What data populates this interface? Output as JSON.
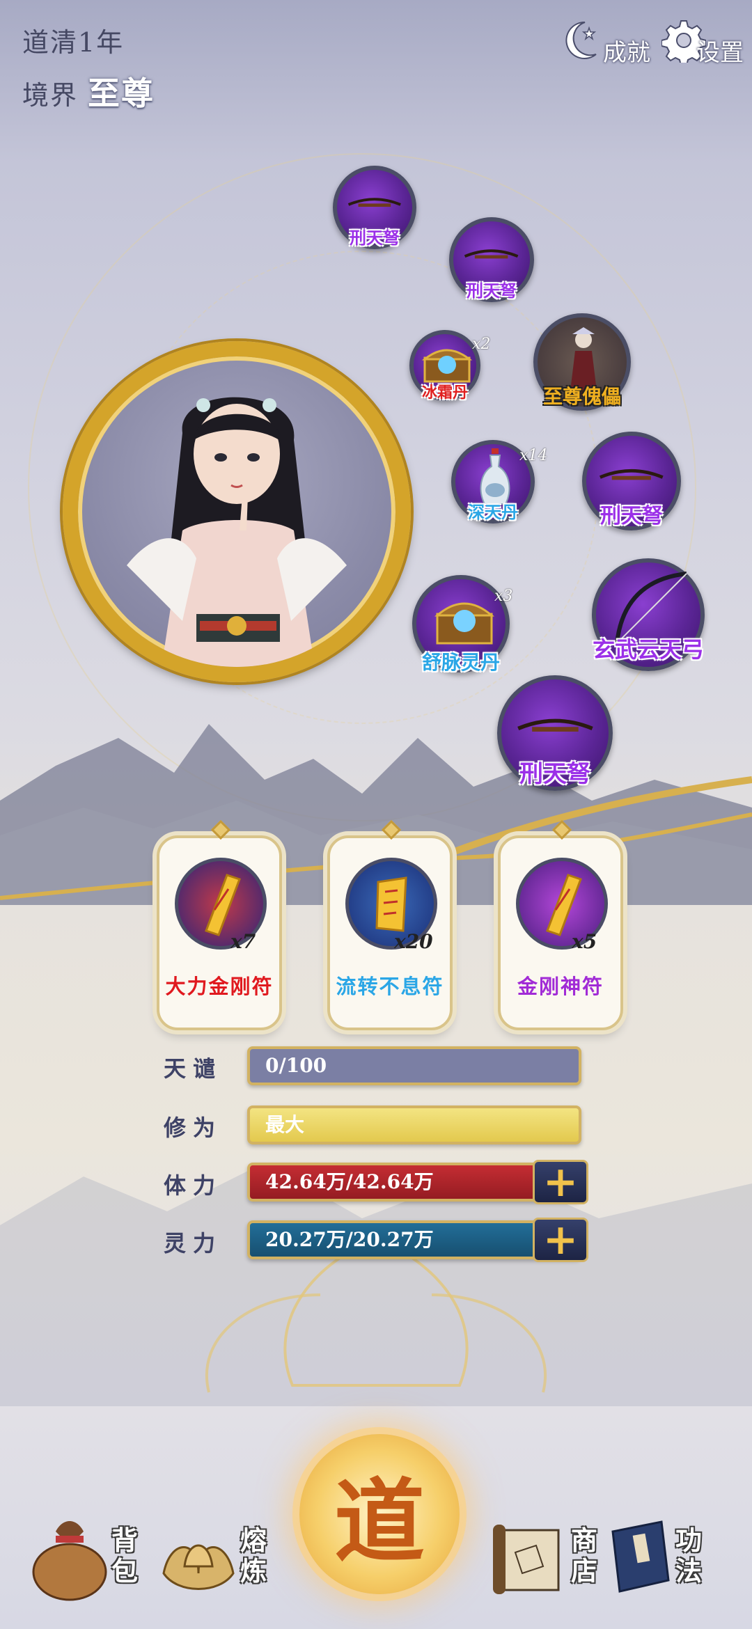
{
  "header": {
    "years": "道清1年",
    "realm_label": "境界",
    "realm_value": "至尊",
    "achievements_label": "成就",
    "settings_label": "设置"
  },
  "items": [
    {
      "name": "刑天弩",
      "kind": "bow-icon"
    },
    {
      "name": "刑天弩",
      "kind": "bow-icon"
    },
    {
      "name": "冰霜丹",
      "count": "x2",
      "kind": "chest-icon"
    },
    {
      "name": "至尊傀儡",
      "kind": "puppet-icon"
    },
    {
      "name": "深天丹",
      "count": "x14",
      "kind": "vase-icon"
    },
    {
      "name": "刑天弩",
      "kind": "bow-icon"
    },
    {
      "name": "舒脉灵丹",
      "count": "x3",
      "kind": "chest-icon"
    },
    {
      "name": "玄武云天弓",
      "kind": "longbow-icon"
    },
    {
      "name": "刑天弩",
      "kind": "bow-icon"
    }
  ],
  "talismans": [
    {
      "name": "大力金刚符",
      "count": "x7",
      "color": "#e0191f"
    },
    {
      "name": "流转不息符",
      "count": "x20",
      "color": "#2aa6e6"
    },
    {
      "name": "金刚神符",
      "count": "x5",
      "color": "#a12bd6"
    }
  ],
  "stats": {
    "tianqian_label": "天谴",
    "tianqian_value": "0/100",
    "xiuwei_label": "修为",
    "xiuwei_value": "最大",
    "tili_label": "体力",
    "tili_value": "42.64万/42.64万",
    "lingli_label": "灵力",
    "lingli_value": "20.27万/20.27万"
  },
  "nav": {
    "bag": "背包",
    "smelt": "熔炼",
    "dao": "道",
    "shop": "商店",
    "skills": "功法"
  },
  "colors": {
    "bar_gray": "#7b7fa4",
    "bar_yellow": "#ecd76a",
    "bar_red": "#b3242a",
    "bar_blue": "#1b5e86",
    "gold": "#d4a42a"
  }
}
